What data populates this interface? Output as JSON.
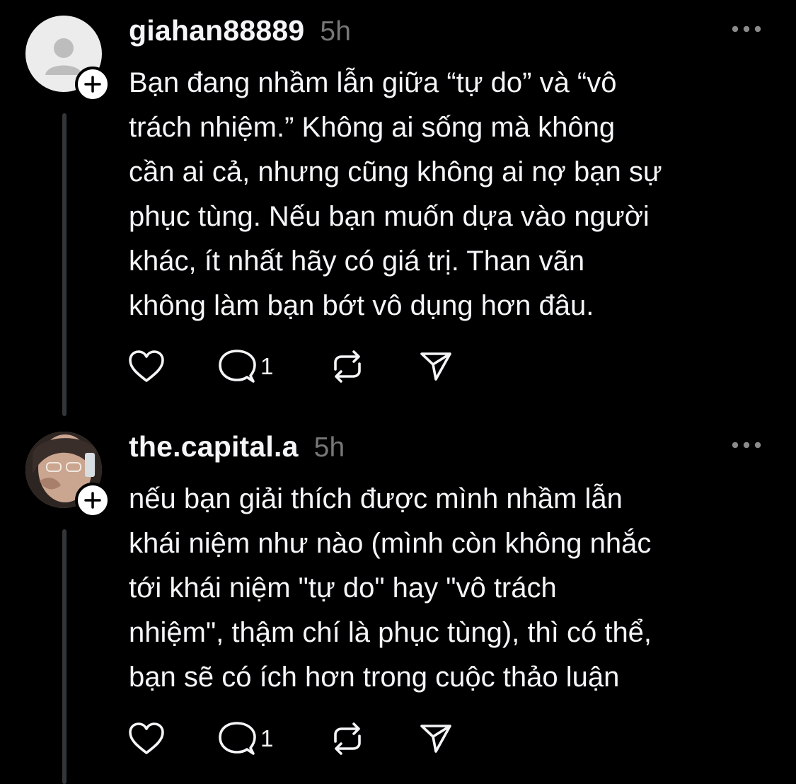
{
  "posts": [
    {
      "username": "giahan88889",
      "time": "5h",
      "avatar_icon": "default-user-icon",
      "lines": [
        "Bạn đang nhầm lẫn giữa “tự do” và “vô",
        "trách nhiệm.” Không ai sống mà không",
        "cần ai cả, nhưng cũng không ai nợ bạn sự",
        "phục tùng. Nếu bạn muốn dựa vào người",
        "khác, ít nhất hãy có giá trị. Than vãn",
        "không làm bạn bớt vô dụng hơn đâu."
      ],
      "reply_count": "1"
    },
    {
      "username": "the.capital.a",
      "time": "5h",
      "avatar_icon": "profile-photo",
      "lines": [
        "nếu bạn giải thích được mình nhầm lẫn",
        "khái niệm như nào (mình còn không nhắc",
        "tới khái niệm \"tự do\" hay \"vô trách",
        "nhiệm\", thậm chí là phục tùng), thì có thể,",
        "bạn sẽ có ích hơn trong cuộc thảo luận"
      ],
      "reply_count": "1"
    }
  ],
  "icons": {
    "like": "heart-icon",
    "reply": "comment-icon",
    "repost": "repost-icon",
    "share": "send-icon",
    "more": "more-dots-icon",
    "follow": "plus-icon"
  },
  "colors": {
    "background": "#000000",
    "text": "#f3f5f7",
    "muted": "#777777",
    "thread_line": "#333638"
  }
}
